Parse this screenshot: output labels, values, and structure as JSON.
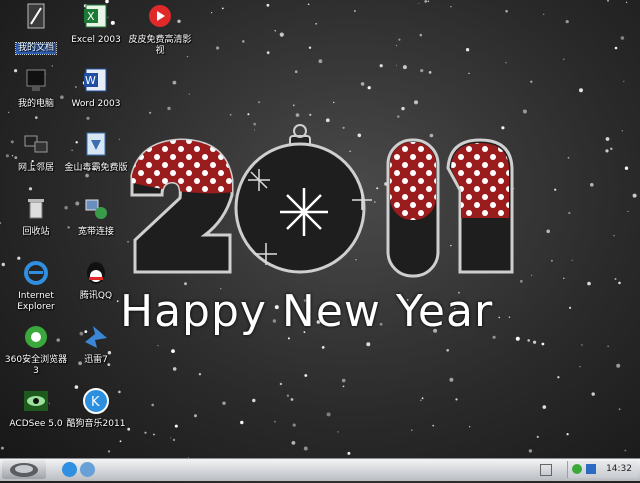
{
  "desktop": {
    "icons": [
      {
        "label": "我的文档",
        "icon": "my-documents-icon"
      },
      {
        "label": "Excel 2003",
        "icon": "excel-icon"
      },
      {
        "label": "皮皮免费高清影视",
        "icon": "pipi-video-icon"
      },
      {
        "label": "我的电脑",
        "icon": "my-computer-icon"
      },
      {
        "label": "Word 2003",
        "icon": "word-icon"
      },
      {
        "label": "网上邻居",
        "icon": "network-places-icon"
      },
      {
        "label": "金山毒霸免费版",
        "icon": "kingsoft-antivirus-icon"
      },
      {
        "label": "回收站",
        "icon": "recycle-bin-icon"
      },
      {
        "label": "宽带连接",
        "icon": "broadband-connection-icon"
      },
      {
        "label": "Internet Explorer",
        "icon": "internet-explorer-icon"
      },
      {
        "label": "腾讯QQ",
        "icon": "qq-icon"
      },
      {
        "label": "360安全浏览器 3",
        "icon": "360-browser-icon"
      },
      {
        "label": "迅雷7",
        "icon": "xunlei-icon"
      },
      {
        "label": "ACDSee 5.0",
        "icon": "acdsee-icon"
      },
      {
        "label": "酷狗音乐2011",
        "icon": "kugou-icon"
      }
    ]
  },
  "wallpaper": {
    "year": "2011",
    "greeting": "Happy New Year",
    "colors": {
      "red": "#9b1c1c",
      "dark": "#1e1e1e",
      "outline": "#cfcfcf"
    }
  },
  "taskbar": {
    "clock": "14:32",
    "quick_launch": [
      "internet-explorer-icon",
      "show-desktop-icon"
    ]
  }
}
